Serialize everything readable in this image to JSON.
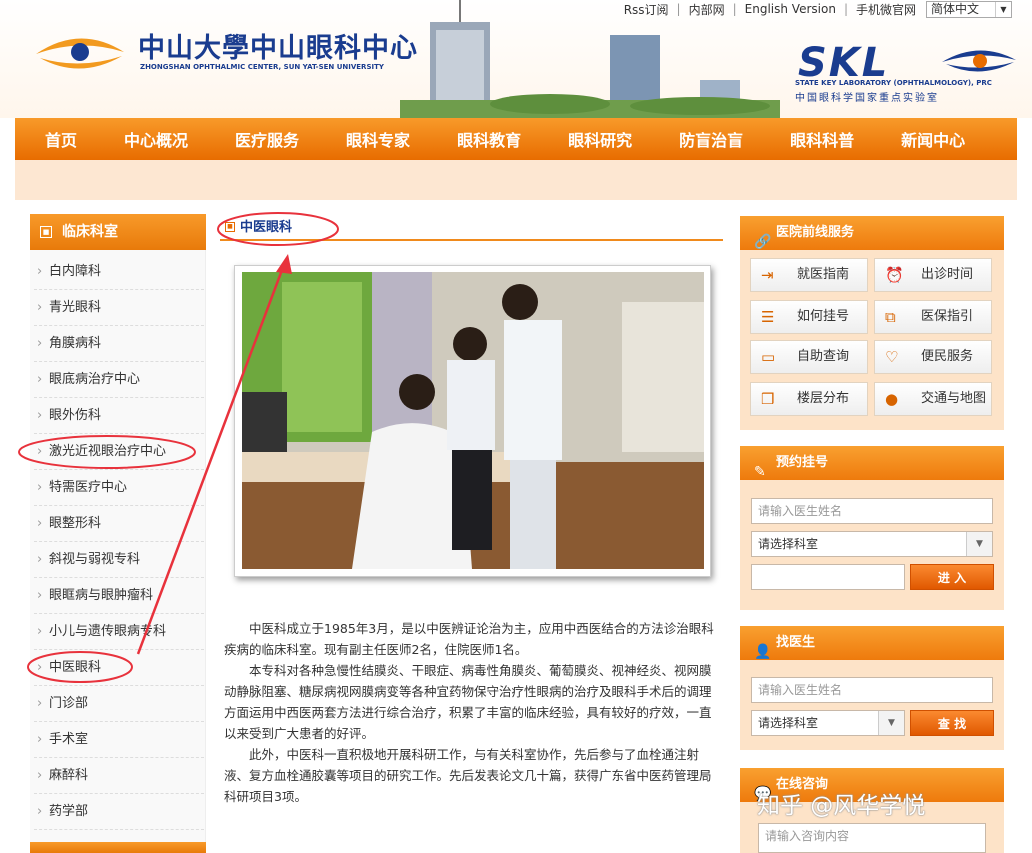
{
  "header": {
    "top_links": [
      "Rss订阅",
      "内部网",
      "English Version",
      "手机微官网"
    ],
    "language": "简体中文",
    "logo_cn": "中山大學中山眼科中心",
    "logo_en": "ZHONGSHAN OPHTHALMIC CENTER, SUN YAT-SEN UNIVERSITY",
    "skl_logo": "SKL",
    "skl_en": "STATE KEY LABORATORY (OPHTHALMOLOGY), PRC",
    "skl_cn": "中国眼科学国家重点实验室"
  },
  "nav": [
    "首页",
    "中心概况",
    "医疗服务",
    "眼科专家",
    "眼科教育",
    "眼科研究",
    "防盲治盲",
    "眼科科普",
    "新闻中心"
  ],
  "sidebar": {
    "title": "临床科室",
    "items": [
      "白内障科",
      "青光眼科",
      "角膜病科",
      "眼底病治疗中心",
      "眼外伤科",
      "激光近视眼治疗中心",
      "特需医疗中心",
      "眼整形科",
      "斜视与弱视专科",
      "眼眶病与眼肿瘤科",
      "小儿与遗传眼病专科",
      "中医眼科",
      "门诊部",
      "手术室",
      "麻醉科",
      "药学部"
    ]
  },
  "main": {
    "title": "中医眼科",
    "paragraphs": [
      "中医科成立于1985年3月，是以中医辨证论治为主，应用中西医结合的方法诊治眼科疾病的临床科室。现有副主任医师2名，住院医师1名。",
      "本专科对各种急慢性结膜炎、干眼症、病毒性角膜炎、葡萄膜炎、视神经炎、视网膜动静脉阻塞、糖尿病视网膜病变等各种宜药物保守治疗性眼病的治疗及眼科手术后的调理方面运用中西医两套方法进行综合治疗，积累了丰富的临床经验，具有较好的疗效，一直以来受到广大患者的好评。",
      "此外，中医科一直积极地开展科研工作，与有关科室协作，先后参与了血栓通注射液、复方血栓通胶囊等项目的研究工作。先后发表论文几十篇，获得广东省中医药管理局科研项目3项。"
    ]
  },
  "services": {
    "title": "医院前线服务",
    "items": [
      {
        "label": "就医指南",
        "icon": "login-arrow-icon"
      },
      {
        "label": "出诊时间",
        "icon": "alarm-clock-icon"
      },
      {
        "label": "如何挂号",
        "icon": "list-icon"
      },
      {
        "label": "医保指引",
        "icon": "copy-icon"
      },
      {
        "label": "自助查询",
        "icon": "monitor-icon"
      },
      {
        "label": "便民服务",
        "icon": "heart-icon"
      },
      {
        "label": "楼层分布",
        "icon": "book-icon"
      },
      {
        "label": "交通与地图",
        "icon": "map-pin-icon"
      }
    ]
  },
  "appointment": {
    "title": "预约挂号",
    "doctor_placeholder": "请输入医生姓名",
    "dept_select": "请选择科室",
    "code_value": "",
    "button": "进 入"
  },
  "find_doctor": {
    "title": "找医生",
    "doctor_placeholder": "请输入医生姓名",
    "dept_select": "请选择科室",
    "button": "查 找"
  },
  "consult": {
    "title": "在线咨询",
    "placeholder": "请输入咨询内容"
  },
  "watermark": "知乎 @风华学悦",
  "colors": {
    "accent": "#f08a1c",
    "nav_bg": "#e86c00",
    "brand_blue": "#1a3c8f",
    "annotation_red": "#e8323c"
  }
}
